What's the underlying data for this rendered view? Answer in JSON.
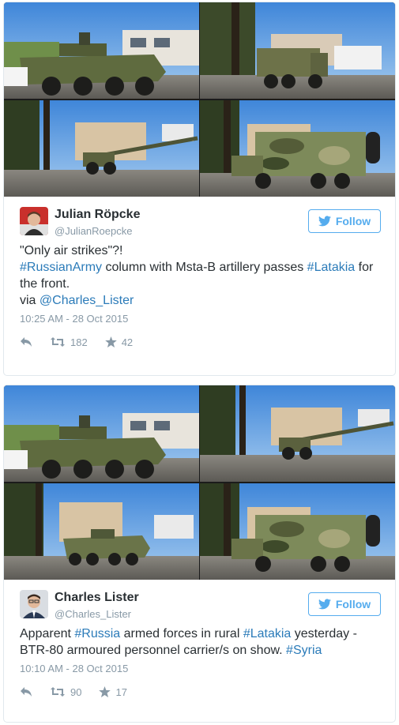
{
  "tweets": [
    {
      "name": "Julian Röpcke",
      "handle": "@JulianRoepcke",
      "follow_label": "Follow",
      "line1": "\"Only air strikes\"?!",
      "line2_tag1": "#RussianArmy",
      "line2_mid": " column with Msta-B artillery passes ",
      "line2_tag2": "#Latakia",
      "line2_end": " for",
      "line3": "the front.",
      "line4_via": "via ",
      "line4_mention": "@Charles_Lister",
      "timestamp": "10:25 AM - 28 Oct 2015",
      "retweets": "182",
      "favorites": "42",
      "photos": [
        "apc-truck-front",
        "military-truck",
        "msta-b-howitzer",
        "camouflage-truck"
      ]
    },
    {
      "name": "Charles Lister",
      "handle": "@Charles_Lister",
      "follow_label": "Follow",
      "line1_pre": "Apparent ",
      "line1_tag1": "#Russia",
      "line1_mid": " armed forces in rural ",
      "line1_tag2": "#Latakia",
      "line1_end": " yesterday -",
      "line2_pre": "BTR-80 armoured personnel carrier/s on show. ",
      "line2_tag": "#Syria",
      "timestamp": "10:10 AM - 28 Oct 2015",
      "retweets": "90",
      "favorites": "17",
      "photos": [
        "apc-truck-front",
        "msta-b-howitzer",
        "btr-80-apc",
        "camouflage-truck"
      ]
    }
  ],
  "colors": {
    "link": "#2b7bb9",
    "follow": "#55acee",
    "meta": "#8899a6",
    "text": "#292f33",
    "border": "#e1e8ed"
  },
  "icons": [
    "reply-icon",
    "retweet-icon",
    "favorite-star-icon",
    "twitter-bird-icon"
  ]
}
